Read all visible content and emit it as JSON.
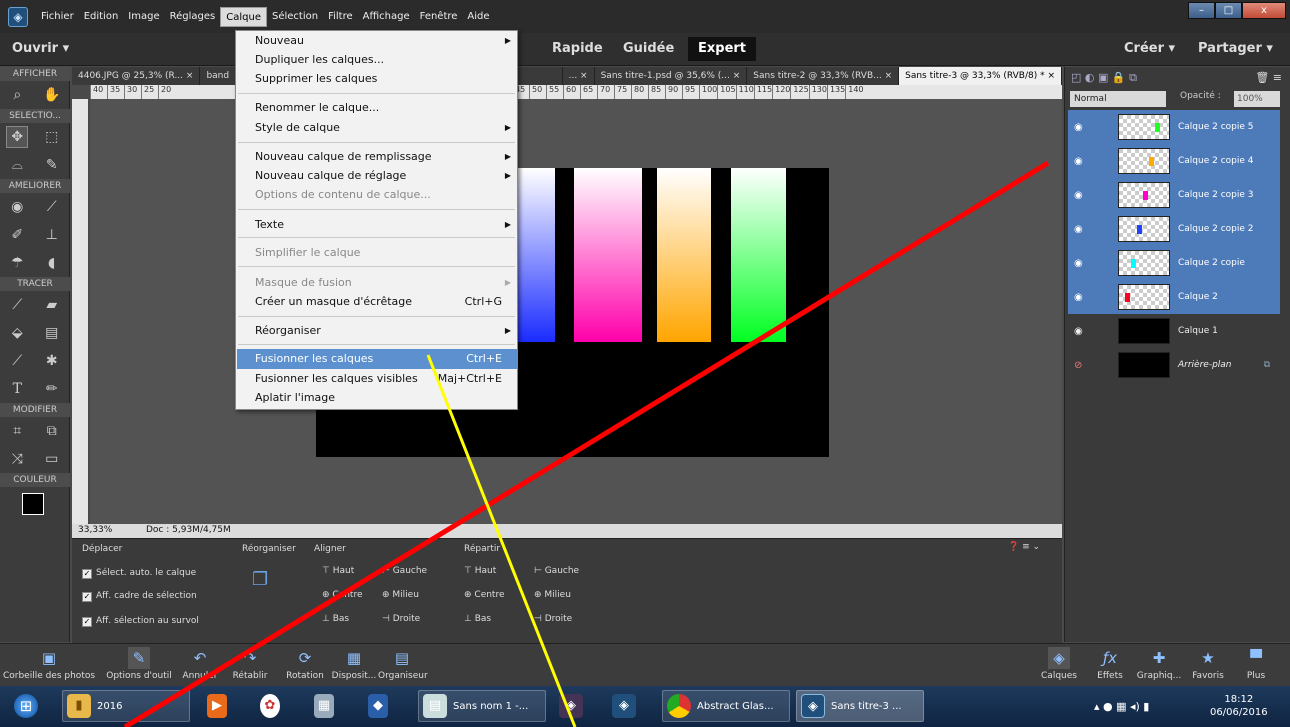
{
  "menubar": {
    "items": [
      "Fichier",
      "Edition",
      "Image",
      "Réglages",
      "Calque",
      "Sélection",
      "Filtre",
      "Affichage",
      "Fenêtre",
      "Aide"
    ],
    "window_controls": [
      "–",
      "□",
      "x"
    ]
  },
  "modebar": {
    "open": "Ouvrir",
    "modes": [
      "Rapide",
      "Guidée",
      "Expert"
    ],
    "create": "Créer",
    "share": "Partager"
  },
  "tabs": [
    "4406.JPG @ 25,3% (R...",
    "band",
    "... ×",
    "Sans titre-1.psd @ 35,6% (...",
    "Sans titre-2 @ 33,3% (RVB...",
    "Sans titre-3 @ 33,3% (RVB/8) *"
  ],
  "toolbox": {
    "sections": [
      "AFFICHER",
      "SELECTIO...",
      "AMELIORER",
      "TRACER",
      "MODIFIER",
      "COULEUR"
    ]
  },
  "ruler_top": [
    "40",
    "35",
    "30",
    "25",
    "20",
    "40",
    "45",
    "50",
    "55",
    "60",
    "65",
    "70",
    "75",
    "80",
    "85",
    "90",
    "95",
    "100",
    "105",
    "110",
    "115",
    "120",
    "125",
    "130",
    "135",
    "140"
  ],
  "statusbar": {
    "zoom": "33,33%",
    "doc": "Doc : 5,93M/4,75M"
  },
  "options": {
    "tool": "Déplacer",
    "reorganize": "Réorganiser",
    "align": "Aligner",
    "distribute": "Répartir",
    "checks": [
      "Sélect. auto. le calque",
      "Aff. cadre de sélection",
      "Aff. sélection au survol"
    ],
    "align_items": [
      "Haut",
      "Gauche",
      "Centre",
      "Milieu",
      "Bas",
      "Droite"
    ],
    "dist_items": [
      "Haut",
      "Gauche",
      "Centre",
      "Milieu",
      "Bas",
      "Droite"
    ]
  },
  "layers_panel": {
    "blend_mode": "Normal",
    "opacity_label": "Opacité :",
    "opacity_value": "100%",
    "layers": [
      {
        "name": "Calque 2 copie 5",
        "selected": true,
        "marker": "#22ff22"
      },
      {
        "name": "Calque 2 copie 4",
        "selected": true,
        "marker": "#ffaa00"
      },
      {
        "name": "Calque 2 copie 3",
        "selected": true,
        "marker": "#ff00cc"
      },
      {
        "name": "Calque 2 copie 2",
        "selected": true,
        "marker": "#2244ff"
      },
      {
        "name": "Calque 2 copie",
        "selected": true,
        "marker": "#00ffff"
      },
      {
        "name": "Calque 2",
        "selected": true,
        "marker": "#ff0022"
      },
      {
        "name": "Calque 1",
        "selected": false,
        "marker": ""
      },
      {
        "name": "Arrière-plan",
        "selected": false,
        "marker": ""
      }
    ]
  },
  "menu": {
    "items": [
      {
        "label": "Nouveau",
        "shortcut": "",
        "arrow": true,
        "disabled": false
      },
      {
        "label": "Dupliquer les calques...",
        "shortcut": "",
        "arrow": false,
        "disabled": false
      },
      {
        "label": "Supprimer les calques",
        "shortcut": "",
        "arrow": false,
        "disabled": false
      },
      {
        "label": "Renommer le calque...",
        "shortcut": "",
        "arrow": false,
        "disabled": false
      },
      {
        "label": "Style de calque",
        "shortcut": "",
        "arrow": true,
        "disabled": false
      },
      {
        "label": "Nouveau calque de remplissage",
        "shortcut": "",
        "arrow": true,
        "disabled": false
      },
      {
        "label": "Nouveau calque de réglage",
        "shortcut": "",
        "arrow": true,
        "disabled": false
      },
      {
        "label": "Options de contenu de calque...",
        "shortcut": "",
        "arrow": false,
        "disabled": true
      },
      {
        "label": "Texte",
        "shortcut": "",
        "arrow": true,
        "disabled": false
      },
      {
        "label": "Simplifier le calque",
        "shortcut": "",
        "arrow": false,
        "disabled": true
      },
      {
        "label": "Masque de fusion",
        "shortcut": "",
        "arrow": true,
        "disabled": true
      },
      {
        "label": "Créer un masque d'écrêtage",
        "shortcut": "Ctrl+G",
        "arrow": false,
        "disabled": false
      },
      {
        "label": "Réorganiser",
        "shortcut": "",
        "arrow": true,
        "disabled": false
      },
      {
        "label": "Fusionner les calques",
        "shortcut": "Ctrl+E",
        "arrow": false,
        "disabled": false,
        "highlighted": true
      },
      {
        "label": "Fusionner les calques visibles",
        "shortcut": "Maj+Ctrl+E",
        "arrow": false,
        "disabled": false
      },
      {
        "label": "Aplatir l'image",
        "shortcut": "",
        "arrow": false,
        "disabled": false
      }
    ]
  },
  "taskpanel": [
    "Corbeille des photos",
    "Options d'outil",
    "Annuler",
    "Rétablir",
    "Rotation",
    "Disposit...",
    "Organiseur",
    "Calques",
    "Effets",
    "Graphiq...",
    "Favoris",
    "Plus"
  ],
  "taskbar": {
    "items": [
      "2016",
      "Sans nom 1 -...",
      "Abstract Glas...",
      "Sans titre-3 ..."
    ],
    "time": "18:12",
    "date": "06/06/2016"
  },
  "colors": {
    "selected_layer": "#4d7ab8",
    "menu_highlight": "#5d90cf",
    "overlay_red": "#ff0000",
    "overlay_yellow": "#ffff00"
  }
}
